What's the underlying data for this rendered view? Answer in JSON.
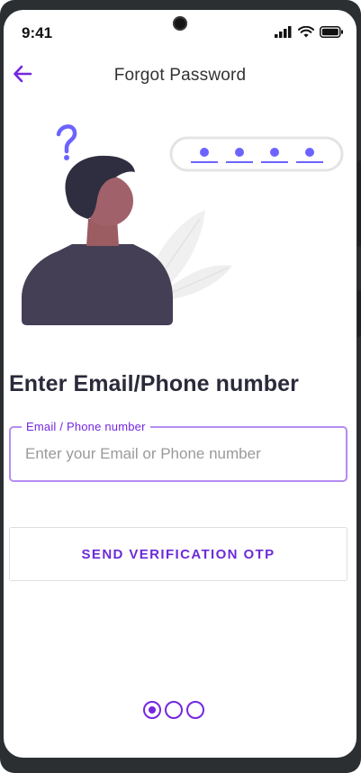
{
  "status_bar": {
    "time": "9:41"
  },
  "header": {
    "title": "Forgot Password"
  },
  "main": {
    "heading": "Enter Email/Phone number",
    "field": {
      "label": "Email / Phone number",
      "placeholder": "Enter your Email or Phone number",
      "value": ""
    },
    "send_button": "SEND VERIFICATION OTP"
  },
  "stepper": {
    "total": 3,
    "current": 1
  },
  "colors": {
    "accent": "#7427e0",
    "field_border": "#b48cf2",
    "heading": "#2a2a3a",
    "figure_body": "#453f56",
    "figure_skin": "#a0616a",
    "figure_hair": "#2f2e41",
    "question_mark": "#6c63ff"
  },
  "icons": {
    "back": "back-arrow-icon",
    "signal": "cellular-signal-icon",
    "wifi": "wifi-icon",
    "battery": "battery-icon"
  }
}
